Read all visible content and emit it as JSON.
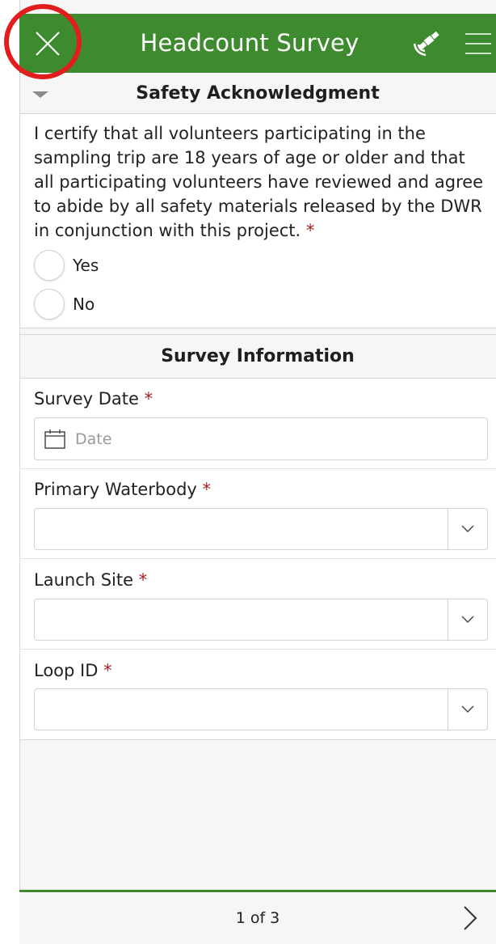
{
  "header": {
    "title": "Headcount Survey",
    "close_icon": "close-icon",
    "gps_icon": "satellite-icon",
    "menu_icon": "hamburger-menu-icon",
    "color": "#3d8a2f"
  },
  "safety": {
    "title": "Safety Acknowledgment",
    "statement": "I certify that all volunteers participating in the sampling trip are 18 years of age or older and that all participating volunteers have reviewed and agree to abide by all safety materials released by the DWR in conjunction with this project.",
    "required_mark": "*",
    "options": [
      "Yes",
      "No"
    ]
  },
  "survey_info": {
    "title": "Survey Information",
    "survey_date": {
      "label": "Survey Date",
      "required_mark": "*",
      "placeholder": "Date"
    },
    "primary_waterbody": {
      "label": "Primary Waterbody",
      "required_mark": "*",
      "value": ""
    },
    "launch_site": {
      "label": "Launch Site",
      "required_mark": "*",
      "value": ""
    },
    "loop_id": {
      "label": "Loop ID",
      "required_mark": "*",
      "value": ""
    }
  },
  "footer": {
    "page_indicator": "1 of 3"
  },
  "colors": {
    "accent": "#3d8a2f",
    "required": "#a32020",
    "highlight": "#e21d1d"
  }
}
